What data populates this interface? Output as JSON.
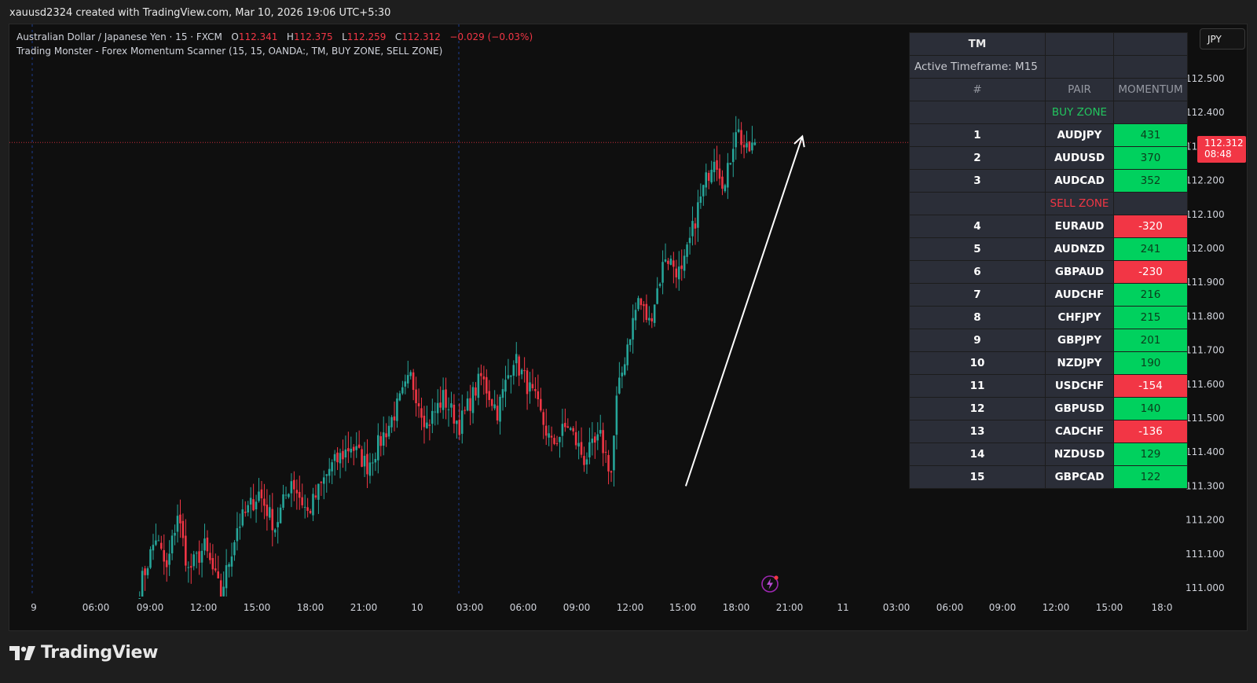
{
  "caption": "xauusd2324 created with TradingView.com, Mar 10, 2026 19:06 UTC+5:30",
  "legend": {
    "symbol": "Australian Dollar / Japanese Yen · 15 · FXCM",
    "o_label": "O",
    "o_value": "112.341",
    "h_label": "H",
    "h_value": "112.375",
    "l_label": "L",
    "l_value": "112.259",
    "c_label": "C",
    "c_value": "112.312",
    "change": "−0.029 (−0.03%)",
    "indicator": "Trading Monster - Forex Momentum Scanner (15, 15, OANDA:, TM, BUY ZONE, SELL ZONE)"
  },
  "currency_button": "JPY",
  "price_tag": {
    "price": "112.312",
    "countdown": "08:48"
  },
  "branding": "TradingView",
  "colors": {
    "up": "#26a69a",
    "down": "#f23645",
    "buy": "#00d15e",
    "sell": "#f23645",
    "background": "#0f0f0f"
  },
  "scanner": {
    "title": "TM",
    "active_timeframe": "Active Timeframe: M15",
    "col_rank": "#",
    "col_pair": "PAIR",
    "col_momentum": "MOMENTUM",
    "buy_zone": "BUY ZONE",
    "sell_zone": "SELL ZONE",
    "buy_rows": [
      {
        "rank": "1",
        "pair": "AUDJPY",
        "momentum": "431"
      },
      {
        "rank": "2",
        "pair": "AUDUSD",
        "momentum": "370"
      },
      {
        "rank": "3",
        "pair": "AUDCAD",
        "momentum": "352"
      }
    ],
    "sell_rows": [
      {
        "rank": "4",
        "pair": "EURAUD",
        "momentum": "-320"
      },
      {
        "rank": "5",
        "pair": "AUDNZD",
        "momentum": "241"
      },
      {
        "rank": "6",
        "pair": "GBPAUD",
        "momentum": "-230"
      },
      {
        "rank": "7",
        "pair": "AUDCHF",
        "momentum": "216"
      },
      {
        "rank": "8",
        "pair": "CHFJPY",
        "momentum": "215"
      },
      {
        "rank": "9",
        "pair": "GBPJPY",
        "momentum": "201"
      },
      {
        "rank": "10",
        "pair": "NZDJPY",
        "momentum": "190"
      },
      {
        "rank": "11",
        "pair": "USDCHF",
        "momentum": "-154"
      },
      {
        "rank": "12",
        "pair": "GBPUSD",
        "momentum": "140"
      },
      {
        "rank": "13",
        "pair": "CADCHF",
        "momentum": "-136"
      },
      {
        "rank": "14",
        "pair": "NZDUSD",
        "momentum": "129"
      },
      {
        "rank": "15",
        "pair": "GBPCAD",
        "momentum": "122"
      }
    ]
  },
  "chart_data": {
    "type": "candlestick",
    "ylim": [
      110.95,
      112.62
    ],
    "y_ticks": [
      "112.500",
      "112.400",
      "112.300",
      "112.200",
      "112.100",
      "112.000",
      "111.900",
      "111.800",
      "111.700",
      "111.600",
      "111.500",
      "111.400",
      "111.300",
      "111.200",
      "111.100",
      "111.000"
    ],
    "x_ticks": [
      "9",
      "06:00",
      "09:00",
      "12:00",
      "15:00",
      "18:00",
      "21:00",
      "10",
      "03:00",
      "06:00",
      "09:00",
      "12:00",
      "15:00",
      "18:00",
      "21:00",
      "11",
      "03:00",
      "06:00",
      "09:00",
      "12:00",
      "15:00",
      "18:0"
    ],
    "last_price": 112.312,
    "grid": false,
    "path": [
      [
        0,
        111.0
      ],
      [
        6,
        111.15
      ],
      [
        10,
        111.05
      ],
      [
        14,
        111.22
      ],
      [
        18,
        111.05
      ],
      [
        24,
        111.12
      ],
      [
        30,
        110.98
      ],
      [
        36,
        111.18
      ],
      [
        44,
        111.28
      ],
      [
        50,
        111.18
      ],
      [
        56,
        111.32
      ],
      [
        62,
        111.22
      ],
      [
        70,
        111.35
      ],
      [
        78,
        111.42
      ],
      [
        84,
        111.36
      ],
      [
        92,
        111.48
      ],
      [
        100,
        111.62
      ],
      [
        106,
        111.48
      ],
      [
        112,
        111.56
      ],
      [
        118,
        111.48
      ],
      [
        126,
        111.62
      ],
      [
        132,
        111.52
      ],
      [
        138,
        111.68
      ],
      [
        146,
        111.55
      ],
      [
        152,
        111.42
      ],
      [
        158,
        111.48
      ],
      [
        164,
        111.38
      ],
      [
        170,
        111.44
      ],
      [
        174,
        111.34
      ],
      [
        176,
        111.55
      ],
      [
        180,
        111.72
      ],
      [
        184,
        111.85
      ],
      [
        188,
        111.78
      ],
      [
        194,
        111.98
      ],
      [
        200,
        111.92
      ],
      [
        206,
        112.12
      ],
      [
        212,
        112.28
      ],
      [
        216,
        112.18
      ],
      [
        220,
        112.36
      ],
      [
        224,
        112.28
      ],
      [
        227,
        112.312
      ]
    ],
    "arrow": {
      "from_bar": 202,
      "from_price": 111.3,
      "to_bar": 245,
      "to_price": 112.33
    }
  }
}
